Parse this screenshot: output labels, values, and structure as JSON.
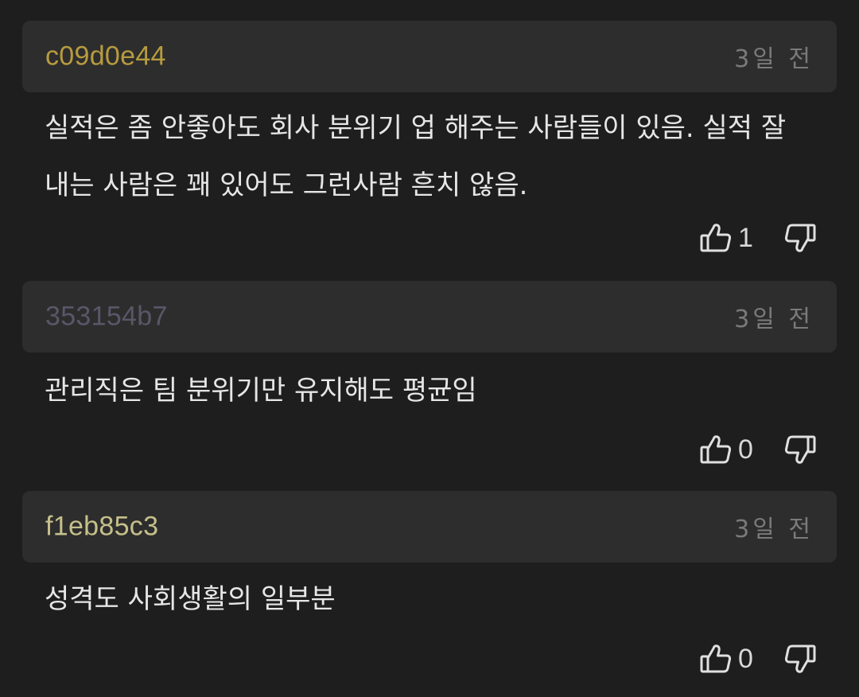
{
  "colors": {
    "background": "#1e1e1e",
    "header_bg": "#2d2d2d",
    "text": "#e6e6e6",
    "time": "#7a7a7a"
  },
  "comments": [
    {
      "author": "c09d0e44",
      "author_color": "#b79b3e",
      "time": "3일 전",
      "text": "실적은 좀 안좋아도 회사 분위기 업 해주는 사람들이 있음. 실적 잘\n내는 사람은 꽤 있어도 그런사람 흔치 않음.",
      "likes": "1",
      "like_icon": "thumbs-up-icon",
      "dislike_icon": "thumbs-down-icon"
    },
    {
      "author": "353154b7",
      "author_color": "#5a5668",
      "time": "3일 전",
      "text": "관리직은 팀 분위기만 유지해도 평균임",
      "likes": "0",
      "like_icon": "thumbs-up-icon",
      "dislike_icon": "thumbs-down-icon"
    },
    {
      "author": "f1eb85c3",
      "author_color": "#c5c08a",
      "time": "3일 전",
      "text": "성격도 사회생활의 일부분",
      "likes": "0",
      "like_icon": "thumbs-up-icon",
      "dislike_icon": "thumbs-down-icon"
    }
  ]
}
